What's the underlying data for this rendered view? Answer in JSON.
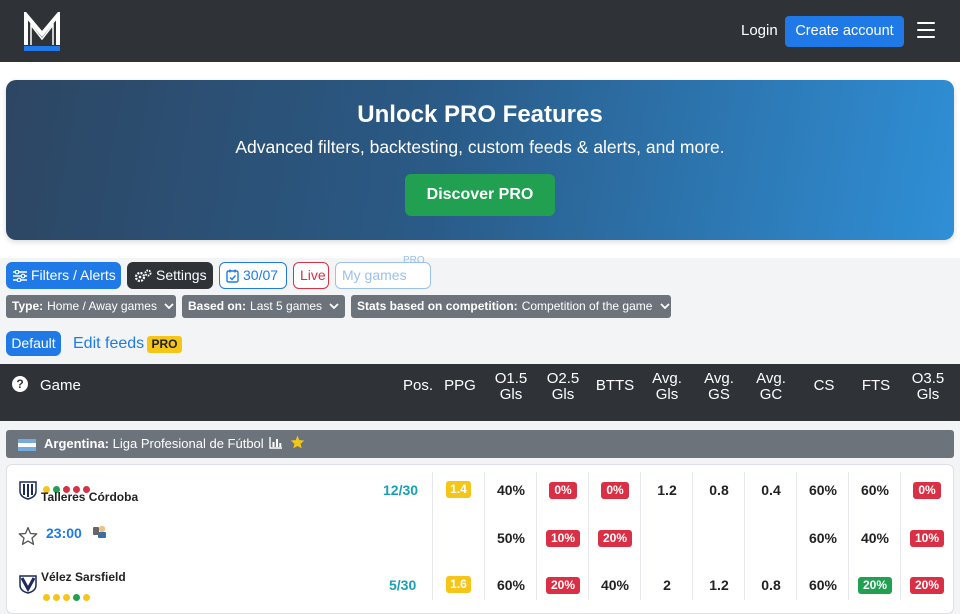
{
  "header": {
    "logo_letter": "M",
    "login_label": "Login",
    "create_account_label": "Create account"
  },
  "promo": {
    "title": "Unlock PRO Features",
    "subtitle": "Advanced filters, backtesting, custom feeds & alerts, and more.",
    "cta_label": "Discover PRO"
  },
  "toolbar": {
    "filters_label": "Filters / Alerts",
    "settings_label": "Settings",
    "date_label": "30/07",
    "live_label": "Live",
    "my_games_label": "My games",
    "my_games_pro_tag": "PRO"
  },
  "selects": {
    "type": {
      "label": "Type:",
      "value": "Home / Away games"
    },
    "based_on": {
      "label": "Based on:",
      "value": "Last 5 games"
    },
    "competition": {
      "label": "Stats based on competition:",
      "value": "Competition of the game"
    }
  },
  "feeds": {
    "default_label": "Default",
    "edit_label": "Edit feeds",
    "pro_badge": "PRO"
  },
  "table": {
    "help_symbol": "?",
    "columns": {
      "game": "Game",
      "pos": "Pos.",
      "ppg": "PPG",
      "o15_a": "O1.5",
      "o15_b": "Gls",
      "o25_a": "O2.5",
      "o25_b": "Gls",
      "btts": "BTTS",
      "avg_gls_a": "Avg.",
      "avg_gls_b": "Gls",
      "avg_gs_a": "Avg.",
      "avg_gs_b": "GS",
      "avg_gc_a": "Avg.",
      "avg_gc_b": "GC",
      "cs": "CS",
      "fts": "FTS",
      "o35_a": "O3.5",
      "o35_b": "Gls"
    }
  },
  "competition": {
    "country": "Argentina:",
    "league": "Liga Profesional de Fútbol"
  },
  "match": {
    "kickoff": "23:00",
    "home": {
      "name": "Talleres Córdoba",
      "form": [
        "#f5c518",
        "#20a050",
        "#d93045",
        "#d93045",
        "#d93045"
      ],
      "pos": "12/30",
      "ppg": "1.4",
      "o15": "40%",
      "o25": "0%",
      "btts": "0%",
      "avg_gls": "1.2",
      "avg_gs": "0.8",
      "avg_gc": "0.4",
      "cs": "60%",
      "fts": "60%",
      "o35": "0%"
    },
    "combined": {
      "o15": "50%",
      "o25": "10%",
      "btts": "20%",
      "cs": "60%",
      "fts": "40%",
      "o35": "10%"
    },
    "away": {
      "name": "Vélez Sarsfield",
      "form": [
        "#f5c518",
        "#f5c518",
        "#f5c518",
        "#20a050",
        "#f5c518"
      ],
      "pos": "5/30",
      "ppg": "1.6",
      "o15": "60%",
      "o25": "20%",
      "btts": "40%",
      "avg_gls": "2",
      "avg_gs": "1.2",
      "avg_gc": "0.8",
      "cs": "60%",
      "fts": "20%",
      "o35": "20%"
    }
  },
  "colors": {
    "primary": "#1f7ae8",
    "dark": "#2f3338",
    "gray": "#6c737b",
    "red": "#d93045",
    "green": "#20a050",
    "yellow": "#f5c518",
    "teal": "#1aa0b4"
  }
}
